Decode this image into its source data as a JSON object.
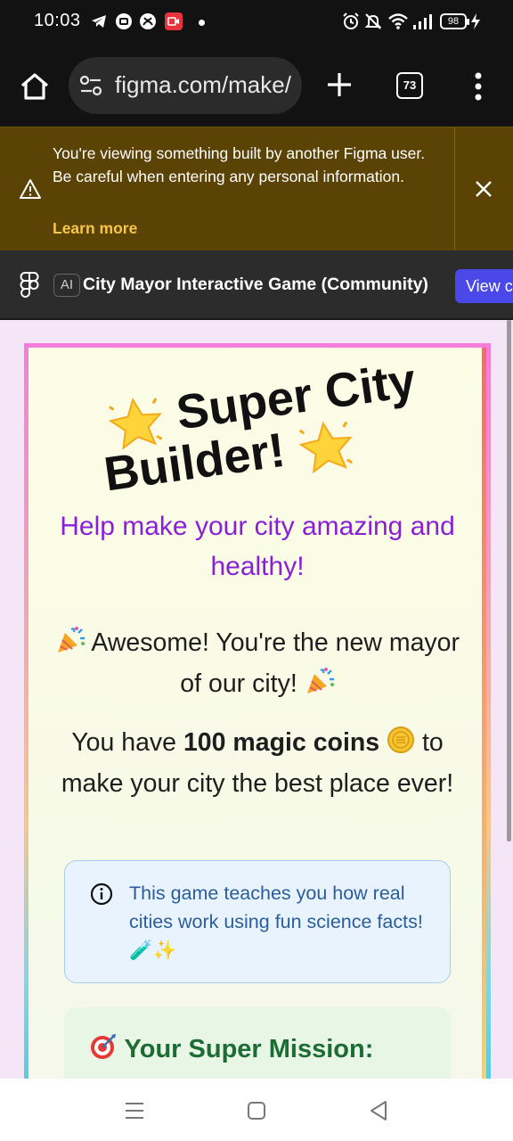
{
  "status": {
    "time": "10:03",
    "battery": "98",
    "icons": [
      "telegram-icon",
      "screen-record-icon",
      "xbox-icon",
      "video-icon",
      "alarm-icon",
      "silent-icon",
      "wifi-icon",
      "signal-icon",
      "charging-icon"
    ]
  },
  "browser": {
    "url": "figma.com/make/",
    "tab_count": "73",
    "icons": [
      "home-icon",
      "site-settings-icon",
      "plus-icon",
      "menu-icon"
    ]
  },
  "warning": {
    "message": "You're viewing something built by another Figma user. Be careful when entering any personal information.",
    "learn_more": "Learn more"
  },
  "figma": {
    "ai_badge": "AI",
    "title": "City Mayor Interactive Game (Community)",
    "view_button": "View c"
  },
  "game": {
    "title_line1": "Super City",
    "title_line2": "Builder!",
    "subtitle": "Help make your city amazing and healthy!",
    "congrats_text": "Awesome! You're the new mayor of our city!",
    "coins_pre": "You have ",
    "coins_bold": "100 magic coins",
    "coins_post": " to make your city the best place ever!",
    "info_text": "This game teaches you how real cities work using fun science facts! 🧪✨",
    "mission_title": "Your Super Mission:"
  },
  "colors": {
    "warning_bg": "#5a4304",
    "link": "#f7c54a",
    "view_button": "#4a48e8",
    "subtitle": "#8a1fd8",
    "info_text": "#2a5d9d",
    "mission_title": "#1d6b35"
  }
}
